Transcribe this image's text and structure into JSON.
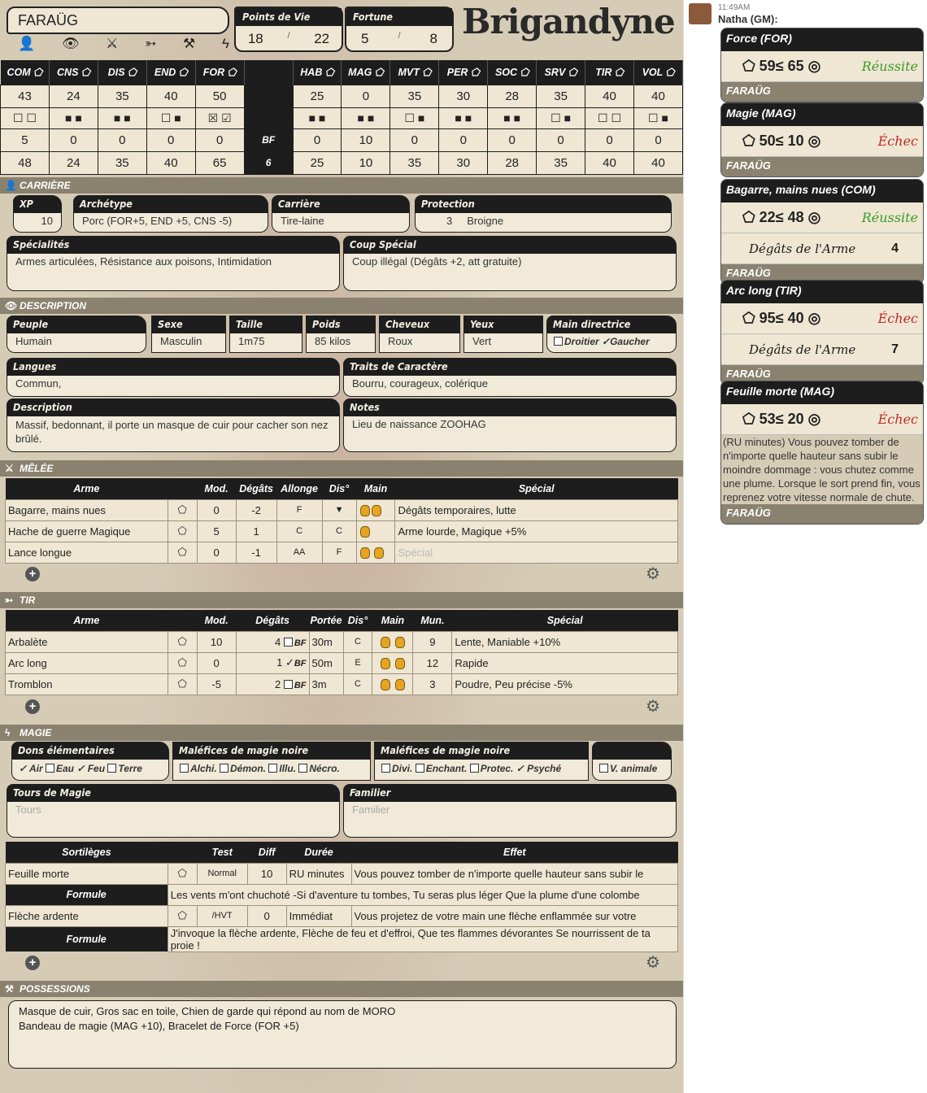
{
  "character": {
    "name": "FARAÜG",
    "logo": "Brigandyne"
  },
  "resources": {
    "pv_label": "Points de Vie",
    "pv_cur": "18",
    "pv_max": "22",
    "fortune_label": "Fortune",
    "f_cur": "5",
    "f_max": "8",
    "sep": "/"
  },
  "tabs_icons": [
    "person-icon",
    "eye-icon",
    "swords-icon",
    "arrows-icon",
    "tools-icon",
    "lightning-icon"
  ],
  "stats": {
    "labels": [
      "COM",
      "CNS",
      "DIS",
      "END",
      "FOR",
      "",
      "HAB",
      "MAG",
      "MVT",
      "PER",
      "SOC",
      "SRV",
      "TIR",
      "VOL"
    ],
    "base": [
      "43",
      "24",
      "35",
      "40",
      "50",
      "",
      "25",
      "0",
      "35",
      "30",
      "28",
      "35",
      "40",
      "40"
    ],
    "marks": [
      "☐ ☐",
      "■ ■",
      "■ ■",
      "☐ ■",
      "☒ ☑",
      "",
      "■ ■",
      "■ ■",
      "☐ ■",
      "■ ■",
      "■ ■",
      "☐ ■",
      "☐ ☐",
      "☐ ■"
    ],
    "mods": [
      "5",
      "0",
      "0",
      "0",
      "0",
      "BF",
      "0",
      "10",
      "0",
      "0",
      "0",
      "0",
      "0",
      "0"
    ],
    "totals": [
      "48",
      "24",
      "35",
      "40",
      "65",
      "6",
      "25",
      "10",
      "35",
      "30",
      "28",
      "35",
      "40",
      "40"
    ]
  },
  "career": {
    "section": "CARRIÈRE",
    "xp_label": "XP",
    "xp": "10",
    "arch_label": "Archétype",
    "arch": "Porc (FOR+5, END +5, CNS -5)",
    "car_label": "Carrière",
    "car": "Tire-laine",
    "prot_label": "Protection",
    "prot_val": "3",
    "prot_name": "Broigne",
    "spec_label": "Spécialités",
    "spec": "Armes articulées, Résistance aux poisons, Intimidation",
    "coup_label": "Coup Spécial",
    "coup": "Coup illégal (Dégâts +2, att gratuite)"
  },
  "desc": {
    "section": "DESCRIPTION",
    "peuple_l": "Peuple",
    "peuple": "Humain",
    "sexe_l": "Sexe",
    "sexe": "Masculin",
    "taille_l": "Taille",
    "taille": "1m75",
    "poids_l": "Poids",
    "poids": "85 kilos",
    "chev_l": "Cheveux",
    "chev": "Roux",
    "yeux_l": "Yeux",
    "yeux": "Vert",
    "main_l": "Main directrice",
    "droitier": "Droitier",
    "gaucher": "Gaucher",
    "lang_l": "Langues",
    "lang": "Commun,",
    "traits_l": "Traits de Caractère",
    "traits": "Bourru, courageux, colérique",
    "d_l": "Description",
    "d": "Massif, bedonnant, il porte un masque de cuir pour cacher son nez brûlé.",
    "notes_l": "Notes",
    "notes": "Lieu de naissance ZOOHAG"
  },
  "melee": {
    "section": "MÊLÉE",
    "h": [
      "Arme",
      "",
      "Mod.",
      "Dégâts",
      "Allonge",
      "Dis°",
      "Main",
      "Spécial"
    ],
    "rows": [
      [
        "Bagarre, mains nues",
        "0",
        "-2",
        "F",
        "▼",
        "Dégâts temporaires, lutte"
      ],
      [
        "Hache de guerre Magique",
        "5",
        "1",
        "C",
        "C",
        "Arme lourde, Magique +5%"
      ],
      [
        "Lance longue",
        "0",
        "-1",
        "AA",
        "F",
        "Spécial"
      ]
    ]
  },
  "tir": {
    "section": "TIR",
    "h": [
      "Arme",
      "",
      "Mod.",
      "Dégâts",
      "Portée",
      "Dis°",
      "Main",
      "Mun.",
      "Spécial"
    ],
    "rows": [
      [
        "Arbalète",
        "10",
        "4",
        "BF",
        "30m",
        "C",
        "9",
        "Lente, Maniable +10%"
      ],
      [
        "Arc long",
        "0",
        "1",
        "BF",
        "50m",
        "E",
        "12",
        "Rapide"
      ],
      [
        "Tromblon",
        "-5",
        "2",
        "BF",
        "3m",
        "C",
        "3",
        "Poudre, Peu précise -5%"
      ]
    ]
  },
  "magie": {
    "section": "MAGIE",
    "dons_l": "Dons élémentaires",
    "dons": [
      "Air",
      "Eau",
      "Feu",
      "Terre"
    ],
    "mal1_l": "Maléfices de magie noire",
    "mal1": [
      "Alchi.",
      "Démon.",
      "Illu.",
      "Nécro."
    ],
    "mal2_l": "Maléfices de magie noire",
    "mal2": [
      "Divi.",
      "Enchant.",
      "Protec.",
      "Psyché"
    ],
    "anim": "V. animale",
    "tours_l": "Tours de Magie",
    "tours_ph": "Tours",
    "fam_l": "Familier",
    "fam_ph": "Familier",
    "sh": [
      "Sortilèges",
      "",
      "Test",
      "Diff",
      "Durée",
      "Effet"
    ],
    "spells": [
      {
        "n": "Feuille morte",
        "t": "Normal",
        "d": "10",
        "du": "RU minutes",
        "e": "Vous pouvez tomber de n'importe quelle hauteur sans subir le",
        "fl": "Formule",
        "f": "Les vents m'ont chuchoté -Si d'aventure tu tombes, Tu seras plus léger Que la plume d'une colombe"
      },
      {
        "n": "Flèche ardente",
        "t": "/HVT",
        "d": "0",
        "du": "Immédiat",
        "e": "Vous projetez de votre main une flèche enflammée sur votre",
        "fl": "Formule",
        "f": "J'invoque la flèche ardente, Flèche de feu et d'effroi, Que tes flammes dévorantes Se nourrissent de ta proie !"
      }
    ]
  },
  "poss": {
    "section": "POSSESSIONS",
    "l1": "Masque de cuir, Gros sac en toile, Chien de garde qui répond au nom de MORO",
    "l2": "Bandeau de magie (MAG +10), Bracelet de Force (FOR +5)"
  },
  "chat": {
    "time": "11:49AM",
    "who": "Natha (GM):",
    "cards": [
      {
        "title": "Force (FOR)",
        "roll": "59",
        "le": "≤",
        "target": "65",
        "res": "Réussite",
        "ok": true,
        "footer": "FARAÜG"
      },
      {
        "title": "Magie (MAG)",
        "roll": "50",
        "le": "≤",
        "target": "10",
        "res": "Échec",
        "ok": false,
        "footer": "FARAÜG"
      },
      {
        "title": "Bagarre, mains nues (COM)",
        "roll": "22",
        "le": "≤",
        "target": "48",
        "res": "Réussite",
        "ok": true,
        "dmg_l": "Dégâts de l'Arme",
        "dmg": "4",
        "footer": "FARAÜG"
      },
      {
        "title": "Arc long (TIR)",
        "roll": "95",
        "le": "≤",
        "target": "40",
        "res": "Échec",
        "ok": false,
        "dmg_l": "Dégâts de l'Arme",
        "dmg": "7",
        "footer": "FARAÜG"
      },
      {
        "title": "Feuille morte (MAG)",
        "roll": "53",
        "le": "≤",
        "target": "20",
        "res": "Échec",
        "ok": false,
        "text": "(RU minutes) Vous pouvez tomber de n'importe quelle hauteur sans subir le moindre dommage : vous chutez comme une plume. Lorsque le sort prend fin, vous reprenez votre vitesse normale de chute.",
        "footer": "FARAÜG"
      }
    ]
  }
}
